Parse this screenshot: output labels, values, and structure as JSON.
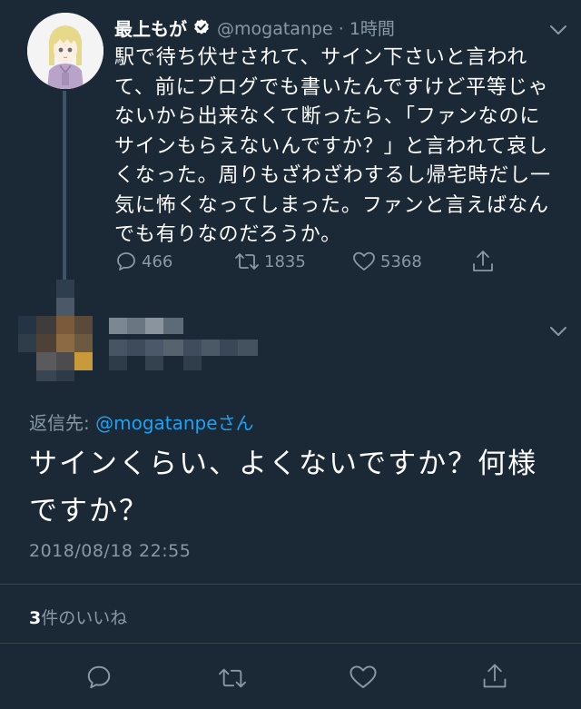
{
  "tweet": {
    "display_name": "最上もが",
    "handle_time": "@mogatanpe · 1時間",
    "text_lines": [
      "駅で待ち伏せされて、サイン下さいと言われ",
      "て、前にブログでも書いたんですけど平等じゃ",
      "ないから出来なくて断ったら、「ファンなのに",
      "サインもらえないんですか？」と言われて哀し",
      "くなった。周りもざわざわするし帰宅時だし一",
      "気に怖くなってしまった。ファンと言えばなん",
      "でも有りなのだろうか。"
    ],
    "actions": {
      "reply_count": "466",
      "retweet_count": "1835",
      "like_count": "5368"
    }
  },
  "reply": {
    "reply_to_label": "返信先: ",
    "reply_to_handle": "@mogatanpe",
    "reply_to_suffix": "さん",
    "text_lines": [
      "サインくらい、よくないですか？何様",
      "ですか？"
    ],
    "timestamp": "2018/08/18 22:55",
    "likes_count": "3",
    "likes_label": "件のいいね"
  },
  "colors": {
    "background": "#1b2836",
    "text": "#ffffff",
    "secondary_text": "#8899a6",
    "link": "#1da1f2",
    "divider": "#38444d",
    "thread_line": "#3d5466"
  },
  "icons": {
    "verified": "verified-badge-icon",
    "menu": "chevron-down-icon",
    "reply": "speech-bubble-icon",
    "retweet": "retweet-arrows-icon",
    "like": "heart-icon",
    "share": "share-upload-icon"
  }
}
